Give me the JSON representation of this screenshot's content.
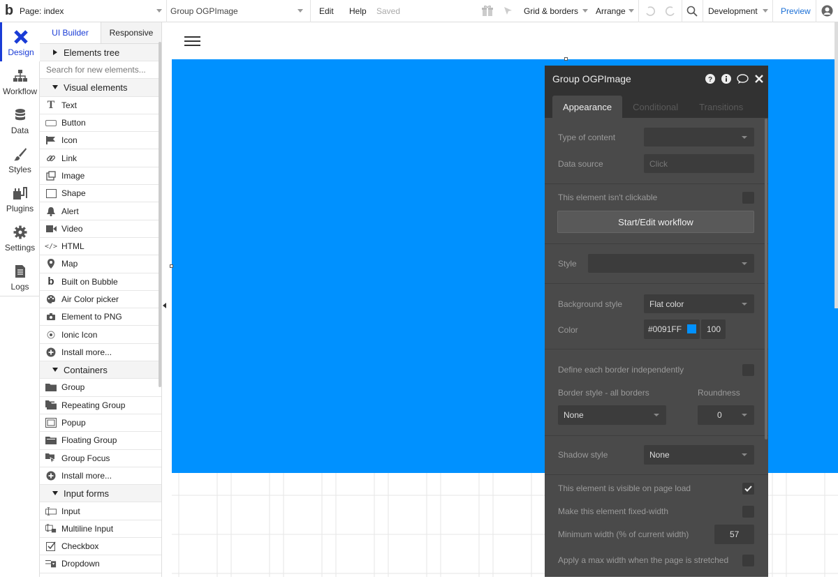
{
  "topbar": {
    "logo": "b",
    "page_label": "Page: index",
    "element_label": "Group OGPImage",
    "menu_edit": "Edit",
    "menu_help": "Help",
    "saved": "Saved",
    "grid_borders": "Grid & borders",
    "arrange": "Arrange",
    "environment": "Development",
    "preview": "Preview"
  },
  "left_nav": [
    {
      "label": "Design",
      "icon": "design-icon"
    },
    {
      "label": "Workflow",
      "icon": "workflow-icon"
    },
    {
      "label": "Data",
      "icon": "database-icon"
    },
    {
      "label": "Styles",
      "icon": "brush-icon"
    },
    {
      "label": "Plugins",
      "icon": "plugin-icon"
    },
    {
      "label": "Settings",
      "icon": "gear-icon"
    },
    {
      "label": "Logs",
      "icon": "document-icon"
    }
  ],
  "panel": {
    "tab_ui_builder": "UI Builder",
    "tab_responsive": "Responsive",
    "elements_tree": "Elements tree",
    "search_placeholder": "Search for new elements...",
    "visual_header": "Visual elements",
    "visual": [
      {
        "label": "Text",
        "icon": "text-icon"
      },
      {
        "label": "Button",
        "icon": "button-icon"
      },
      {
        "label": "Icon",
        "icon": "flag-icon"
      },
      {
        "label": "Link",
        "icon": "link-icon"
      },
      {
        "label": "Image",
        "icon": "image-icon"
      },
      {
        "label": "Shape",
        "icon": "shape-icon"
      },
      {
        "label": "Alert",
        "icon": "bell-icon"
      },
      {
        "label": "Video",
        "icon": "video-icon"
      },
      {
        "label": "HTML",
        "icon": "code-icon"
      },
      {
        "label": "Map",
        "icon": "map-pin-icon"
      },
      {
        "label": "Built on Bubble",
        "icon": "bubble-icon"
      },
      {
        "label": "Air Color picker",
        "icon": "palette-icon"
      },
      {
        "label": "Element to PNG",
        "icon": "camera-icon"
      },
      {
        "label": "Ionic Icon",
        "icon": "ionic-icon"
      },
      {
        "label": "Install more...",
        "icon": "plus-icon"
      }
    ],
    "containers_header": "Containers",
    "containers": [
      {
        "label": "Group",
        "icon": "folder-icon"
      },
      {
        "label": "Repeating Group",
        "icon": "folders-icon"
      },
      {
        "label": "Popup",
        "icon": "popup-icon"
      },
      {
        "label": "Floating Group",
        "icon": "floating-folder-icon"
      },
      {
        "label": "Group Focus",
        "icon": "group-focus-icon"
      },
      {
        "label": "Install more...",
        "icon": "plus-icon"
      }
    ],
    "inputs_header": "Input forms",
    "inputs": [
      {
        "label": "Input",
        "icon": "input-icon"
      },
      {
        "label": "Multiline Input",
        "icon": "multiline-icon"
      },
      {
        "label": "Checkbox",
        "icon": "checkbox-icon"
      },
      {
        "label": "Dropdown",
        "icon": "dropdown-icon"
      }
    ]
  },
  "inspector": {
    "title": "Group OGPImage",
    "tabs": [
      "Appearance",
      "Conditional",
      "Transitions"
    ],
    "type_of_content_label": "Type of content",
    "type_of_content_value": "",
    "data_source_label": "Data source",
    "data_source_placeholder": "Click",
    "not_clickable_label": "This element isn't clickable",
    "workflow_button": "Start/Edit workflow",
    "style_label": "Style",
    "style_value": "",
    "bg_style_label": "Background style",
    "bg_style_value": "Flat color",
    "color_label": "Color",
    "color_hex": "#0091FF",
    "color_opacity": "100",
    "border_indep_label": "Define each border independently",
    "border_style_label": "Border style - all borders",
    "roundness_label": "Roundness",
    "border_style_value": "None",
    "roundness_value": "0",
    "shadow_label": "Shadow style",
    "shadow_value": "None",
    "visible_label": "This element is visible on page load",
    "visible_checked": true,
    "fixed_width_label": "Make this element fixed-width",
    "min_width_label": "Minimum width (% of current width)",
    "min_width_value": "57",
    "max_width_label": "Apply a max width when the page is stretched"
  },
  "colors": {
    "canvas_blue": "#0091ff",
    "accent": "#1a3cd6",
    "inspector_bg": "#4a4a4a"
  }
}
